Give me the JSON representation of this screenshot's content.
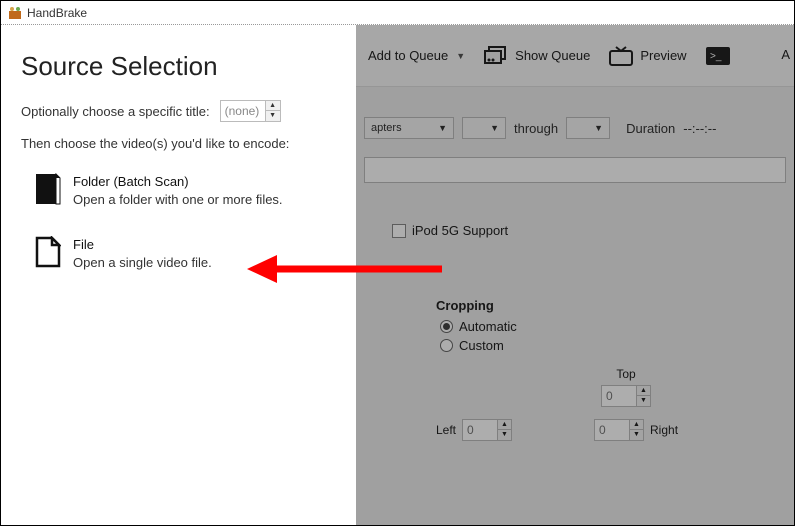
{
  "titlebar": {
    "app_name": "HandBrake"
  },
  "panel": {
    "heading": "Source Selection",
    "optional_label": "Optionally choose a specific title:",
    "title_spinner_value": "(none)",
    "then_label": "Then choose the video(s) you'd like to encode:",
    "folder": {
      "title": "Folder (Batch Scan)",
      "desc": "Open a folder with one or more files."
    },
    "file": {
      "title": "File",
      "desc": "Open a single video file."
    }
  },
  "toolbar": {
    "add_queue": "Add to Queue",
    "show_queue": "Show Queue",
    "preview": "Preview",
    "trailing_letter": "A"
  },
  "row2": {
    "chapters_combo": "apters",
    "through": "through",
    "duration_label": "Duration",
    "duration_value": "--:--:--"
  },
  "ipod": {
    "label": "iPod 5G Support"
  },
  "cropping": {
    "heading": "Cropping",
    "auto": "Automatic",
    "custom": "Custom",
    "top": "Top",
    "left": "Left",
    "right": "Right",
    "top_val": "0",
    "left_val": "0",
    "right_val": "0"
  }
}
